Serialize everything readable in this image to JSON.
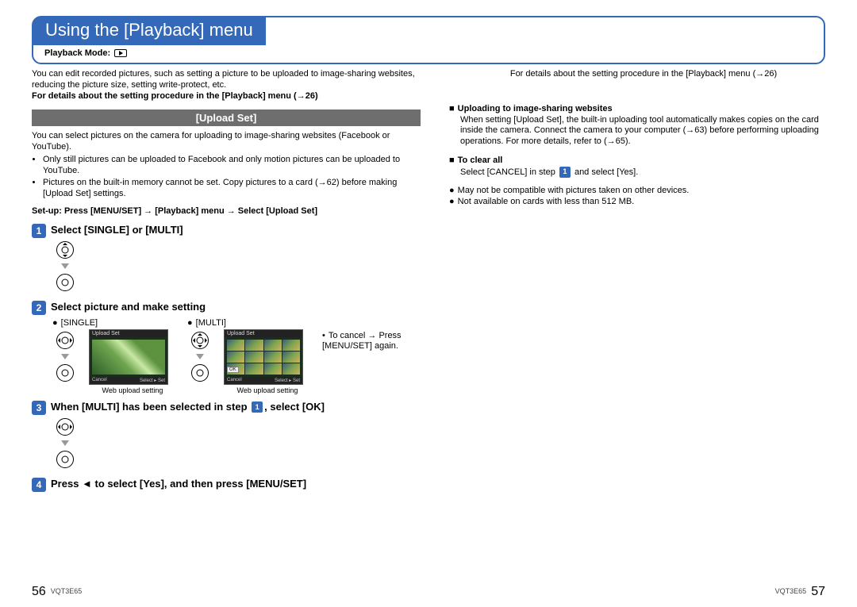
{
  "title": "Using the [Playback] menu",
  "mode_label": "Playback Mode:",
  "left": {
    "intro": "You can edit recorded pictures, such as setting a picture to be uploaded to image-sharing websites, reducing the picture size, setting write-protect, etc.",
    "intro_detail": "For details about the setting procedure in the [Playback] menu (→26)",
    "section_title": "[Upload Set]",
    "upload_desc": "You can select pictures on the camera for uploading to image-sharing websites (Facebook or YouTube).",
    "upload_bullets": [
      "Only still pictures can be uploaded to Facebook and only motion pictures can be uploaded to YouTube.",
      "Pictures on the built-in memory cannot be set. Copy pictures to a card (→62) before making [Upload Set] settings."
    ],
    "setup_line": "Set-up: Press [MENU/SET] → [Playback] menu → Select [Upload Set]",
    "step1_title": "Select [SINGLE] or [MULTI]",
    "step2_title": "Select picture and make setting",
    "step2_single_label": "[SINGLE]",
    "step2_multi_label": "[MULTI]",
    "step2_note": "To cancel → Press [MENU/SET] again.",
    "caption": "Web upload setting",
    "screenshot_header": "Upload Set",
    "screenshot_ok": "OK",
    "screenshot_cancel": "Cancel",
    "screenshot_select_set": "Select ▸ Set",
    "step3_title_pre": "When [MULTI] has been selected in step ",
    "step3_title_post": ", select [OK]",
    "step4_title": "Press ◄ to select [Yes], and then press [MENU/SET]"
  },
  "right": {
    "top_line": "For details about the setting procedure in the [Playback] menu (→26)",
    "h_upload": "Uploading to image-sharing websites",
    "upload_text": "When setting [Upload Set], the built-in uploading tool automatically makes copies on the card inside the camera. Connect the camera to your computer (→63) before performing uploading operations. For more details, refer to (→65).",
    "h_clear": "To clear all",
    "clear_pre": "Select [CANCEL] in step ",
    "clear_post": " and select [Yes].",
    "notes": [
      "May not be compatible with pictures taken on other devices.",
      "Not available on cards with less than 512 MB."
    ]
  },
  "footer": {
    "page_left": "56",
    "page_right": "57",
    "docid": "VQT3E65"
  }
}
